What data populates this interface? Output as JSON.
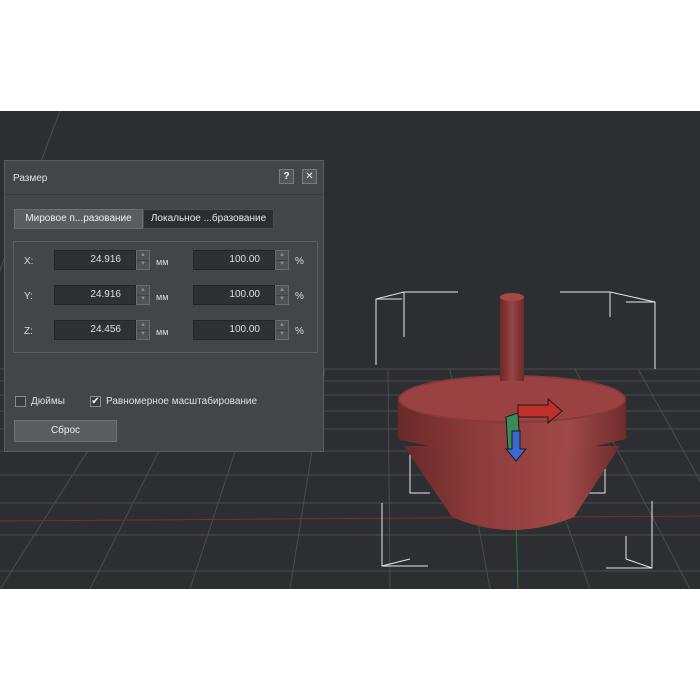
{
  "dialog": {
    "title": "Размер",
    "help_label": "?",
    "close_label": "✕",
    "tabs": [
      {
        "label": "Мировое п...разование",
        "active": true
      },
      {
        "label": "Локальное ...бразование",
        "active": false
      }
    ],
    "rows": [
      {
        "axis": "X:",
        "size": "24.916",
        "unit": "мм",
        "percent": "100.00",
        "percent_unit": "%"
      },
      {
        "axis": "Y:",
        "size": "24.916",
        "unit": "мм",
        "percent": "100.00",
        "percent_unit": "%"
      },
      {
        "axis": "Z:",
        "size": "24.456",
        "unit": "мм",
        "percent": "100.00",
        "percent_unit": "%"
      }
    ],
    "inches": {
      "label": "Дюймы",
      "checked": false
    },
    "uniform": {
      "label": "Равномерное масштабирование",
      "checked": true,
      "mark": "✔"
    },
    "reset_label": "Сброс"
  },
  "viewport": {
    "background": "#2c2e31",
    "model_color": "#8e3b3b",
    "gizmo_colors": {
      "x": "#c0302a",
      "y": "#3a8a5a",
      "z": "#3a6ad0"
    }
  }
}
